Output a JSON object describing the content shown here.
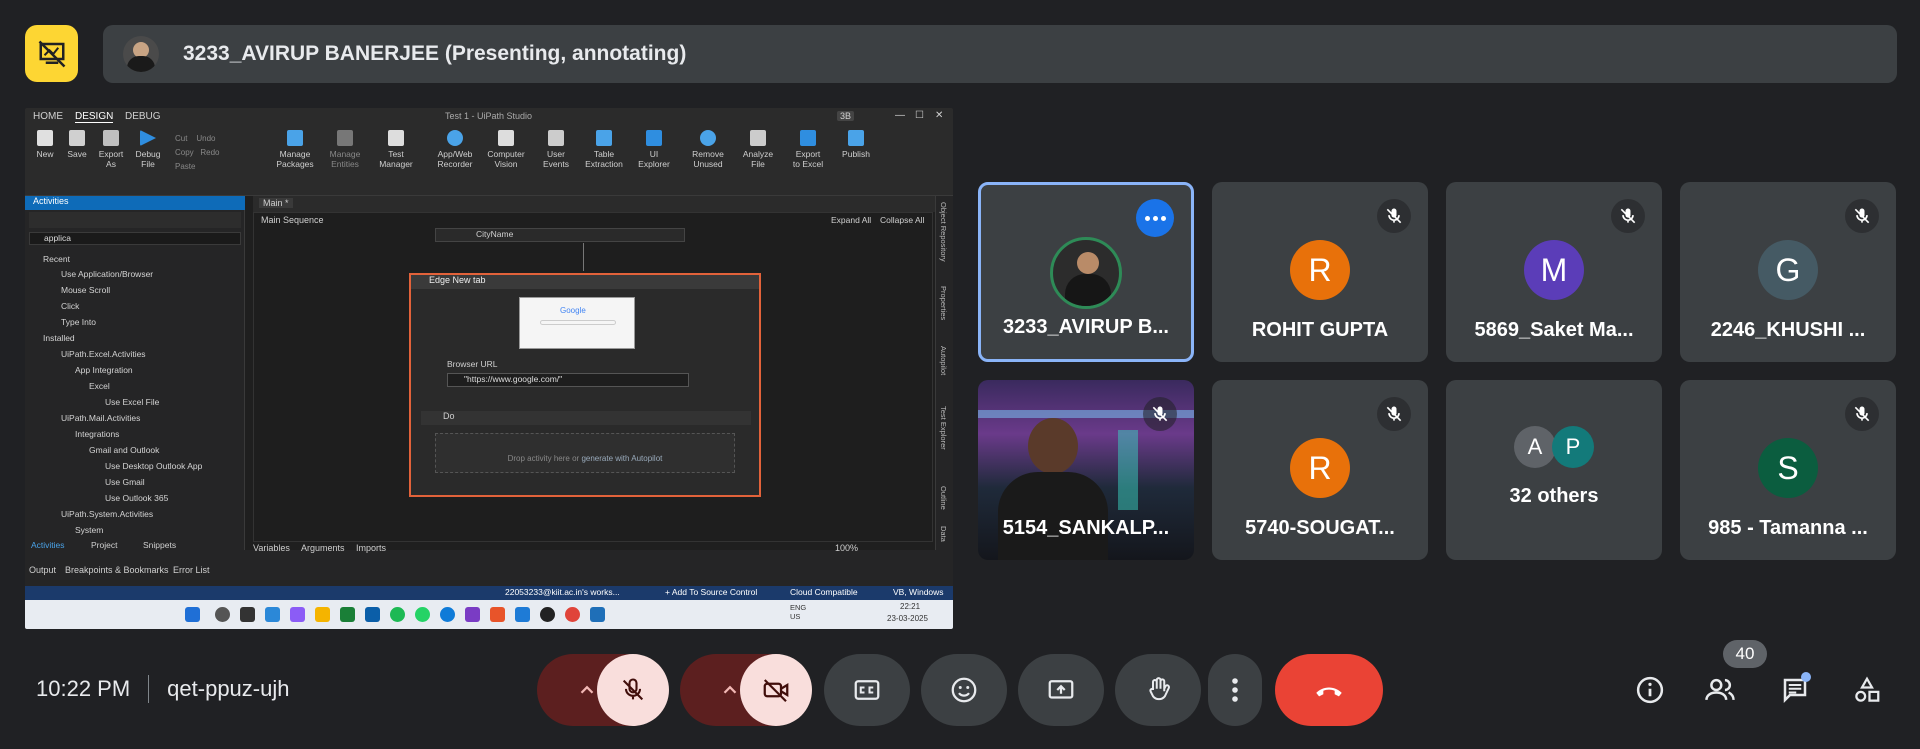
{
  "presenter": {
    "label": "3233_AVIRUP BANERJEE (Presenting, annotating)"
  },
  "shared_screen": {
    "menu": {
      "tabs": [
        "HOME",
        "DESIGN",
        "DEBUG"
      ],
      "window_title": "Test 1 - UiPath Studio",
      "user_initials": "3B"
    },
    "ribbon": [
      {
        "label": "New"
      },
      {
        "label": "Save"
      },
      {
        "label": "Export\nAs"
      },
      {
        "label": "Debug\nFile"
      },
      {
        "label": "Manage\nPackages"
      },
      {
        "label": "Manage\nEntities"
      },
      {
        "label": "Test\nManager"
      },
      {
        "label": "App/Web\nRecorder"
      },
      {
        "label": "Computer\nVision"
      },
      {
        "label": "User\nEvents"
      },
      {
        "label": "Table\nExtraction"
      },
      {
        "label": "UI\nExplorer"
      },
      {
        "label": "Remove\nUnused"
      },
      {
        "label": "Analyze\nFile"
      },
      {
        "label": "Export\nto Excel"
      },
      {
        "label": "Publish"
      }
    ],
    "edit_items": [
      "Cut",
      "Undo",
      "Copy",
      "Redo",
      "Paste"
    ],
    "activities_panel": {
      "title": "Activities",
      "search": "applica",
      "tree": [
        "Recent",
        "Use Application/Browser",
        "Mouse Scroll",
        "Click",
        "Type Into",
        "Installed",
        "UiPath.Excel.Activities",
        "App Integration",
        "Excel",
        "Use Excel File",
        "UiPath.Mail.Activities",
        "Integrations",
        "Gmail and Outlook",
        "Use Desktop Outlook App",
        "Use Gmail",
        "Use Outlook 365",
        "UiPath.System.Activities",
        "System"
      ],
      "bottom_tabs": [
        "Activities",
        "Project",
        "Snippets"
      ]
    },
    "canvas": {
      "tab": "Main *",
      "breadcrumb": "Main Sequence",
      "expand_all": "Expand All",
      "collapse_all": "Collapse All",
      "top_item": "CityName",
      "activity_title": "Edge New tab",
      "preview_text": "Google",
      "browser_url_label": "Browser URL",
      "browser_url_value": "\"https://www.google.com/\"",
      "do_label": "Do",
      "drop_hint": "Drop activity here or",
      "drop_link": "generate with Autopilot"
    },
    "right_rail": [
      "Object Repository",
      "Properties",
      "Autopilot",
      "Test Explorer",
      "Outline",
      "Data"
    ],
    "bottom_bar": {
      "tabs": [
        "Variables",
        "Arguments",
        "Imports"
      ],
      "zoom": "100%"
    },
    "output_tabs": [
      "Output",
      "Breakpoints & Bookmarks",
      "Error List"
    ],
    "status_bar": [
      "22053233@kiit.ac.in's works...",
      "+ Add To Source Control",
      "Cloud Compatible",
      "VB, Windows"
    ],
    "taskbar": {
      "lang": "ENG\nUS",
      "time": "22:21",
      "date": "23-03-2025"
    }
  },
  "participants": [
    {
      "name": "3233_AVIRUP B...",
      "initial": "",
      "color": "#3c4043",
      "type": "photo-avatar",
      "muted": false,
      "highlighted": true
    },
    {
      "name": "ROHIT GUPTA",
      "initial": "R",
      "color": "#e8710a",
      "muted": true
    },
    {
      "name": "5869_Saket Ma...",
      "initial": "M",
      "color": "#5b3db8",
      "muted": true
    },
    {
      "name": "2246_KHUSHI ...",
      "initial": "G",
      "color": "#455a64",
      "muted": true
    },
    {
      "name": "5154_SANKALP...",
      "initial": "",
      "color": "#2b2540",
      "type": "video",
      "muted": true
    },
    {
      "name": "5740-SOUGAT...",
      "initial": "R",
      "color": "#e8710a",
      "muted": true
    },
    {
      "name": "32 others",
      "initial": "",
      "color": "#3c4043",
      "type": "others",
      "others_initials": [
        "A",
        "P"
      ],
      "muted": false
    },
    {
      "name": "985 - Tamanna ...",
      "initial": "S",
      "color": "#0b5d3f",
      "muted": true
    }
  ],
  "bottom": {
    "time": "10:22 PM",
    "meeting_code": "qet-ppuz-ujh",
    "participant_count": "40"
  }
}
